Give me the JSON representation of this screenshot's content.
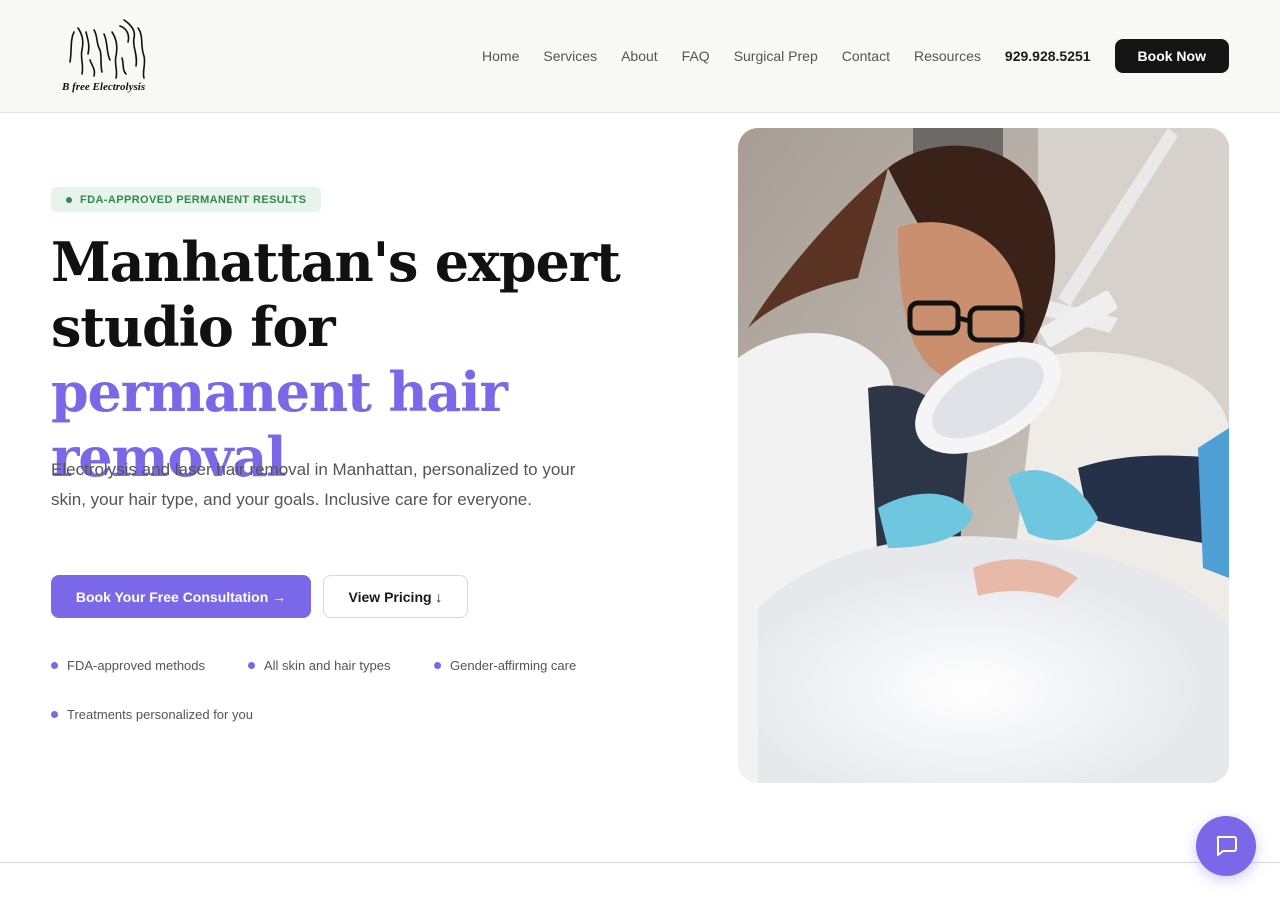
{
  "brand": {
    "name": "B free Electrolysis",
    "logo_icon": "torso-outline-logo"
  },
  "nav": {
    "items": [
      "Home",
      "Services",
      "About",
      "FAQ",
      "Surgical Prep",
      "Contact",
      "Resources"
    ],
    "phone": "929.928.5251",
    "cta": "Book Now"
  },
  "hero": {
    "badge": "FDA-APPROVED PERMANENT RESULTS",
    "headline_plain": "Manhattan's expert studio for ",
    "headline_accent": "permanent hair removal",
    "subtitle": "Electrolysis and laser hair removal in Manhattan, personalized to your skin, your hair type, and your goals. Inclusive care for everyone.",
    "primary_cta": "Book Your Free Consultation →",
    "secondary_cta": "View Pricing ↓",
    "features": [
      "FDA-approved methods",
      "All skin and hair types",
      "Gender-affirming care",
      "Treatments personalized for you"
    ],
    "photo_icon": "electrolysis-treatment-photo"
  },
  "chat": {
    "icon": "chat-bubble-icon"
  },
  "colors": {
    "accent": "#7a68e8",
    "badge_green": "#2f8a4c",
    "dark": "#151515"
  }
}
